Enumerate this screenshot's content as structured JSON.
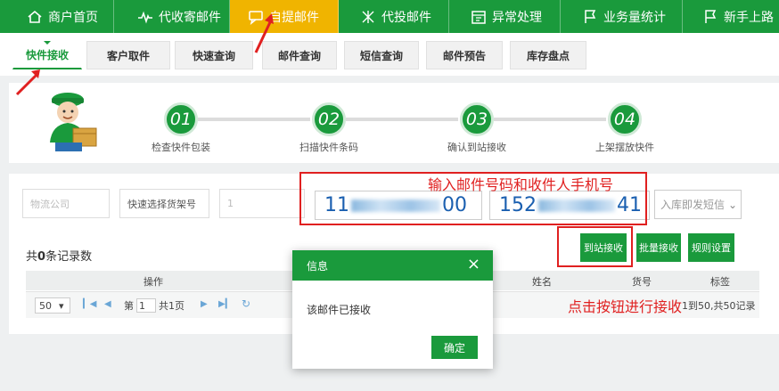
{
  "nav": {
    "items": [
      {
        "label": "商户首页",
        "icon": "home-icon"
      },
      {
        "label": "代收寄邮件",
        "icon": "pulse-icon"
      },
      {
        "label": "自提邮件",
        "icon": "chat-icon"
      },
      {
        "label": "代投邮件",
        "icon": "cross-icon"
      },
      {
        "label": "异常处理",
        "icon": "calendar-icon"
      },
      {
        "label": "业务量统计",
        "icon": "flag-icon"
      },
      {
        "label": "新手上路",
        "icon": "flag-icon"
      }
    ],
    "active_color": "#f0b400",
    "color": "#1a9a3c"
  },
  "subtabs": [
    "快件接收",
    "客户取件",
    "快速查询",
    "邮件查询",
    "短信查询",
    "邮件预告",
    "库存盘点"
  ],
  "steps": [
    {
      "num": "01",
      "label": "检查快件包装"
    },
    {
      "num": "02",
      "label": "扫描快件条码"
    },
    {
      "num": "03",
      "label": "确认到站接收"
    },
    {
      "num": "04",
      "label": "上架摆放快件"
    }
  ],
  "form": {
    "company_placeholder": "物流公司",
    "shelf_button": "快速选择货架号",
    "shelf_value": "1",
    "mail_number_prefix": "11",
    "mail_number_suffix": "00",
    "phone_prefix": "152",
    "phone_suffix": "41",
    "sms_select": "入库即发短信"
  },
  "record_count": {
    "prefix": "共",
    "count": "0",
    "suffix": "条记录数"
  },
  "buttons": {
    "receive": "到站接收",
    "batch": "批量接收",
    "rules": "规则设置"
  },
  "table": {
    "headers": {
      "action": "操作",
      "name": "姓名",
      "goods": "货号",
      "tag": "标签"
    }
  },
  "pager": {
    "page_size": "50",
    "page_prefix": "第",
    "page_value": "1",
    "page_total": "共1页",
    "summary": "1到50,共50记录"
  },
  "annotations": {
    "input_hint": "输入邮件号码和收件人手机号",
    "button_hint": "点击按钮进行接收",
    "color": "#e02020"
  },
  "modal": {
    "title": "信息",
    "message": "该邮件已接收",
    "confirm": "确定",
    "close": "×"
  }
}
